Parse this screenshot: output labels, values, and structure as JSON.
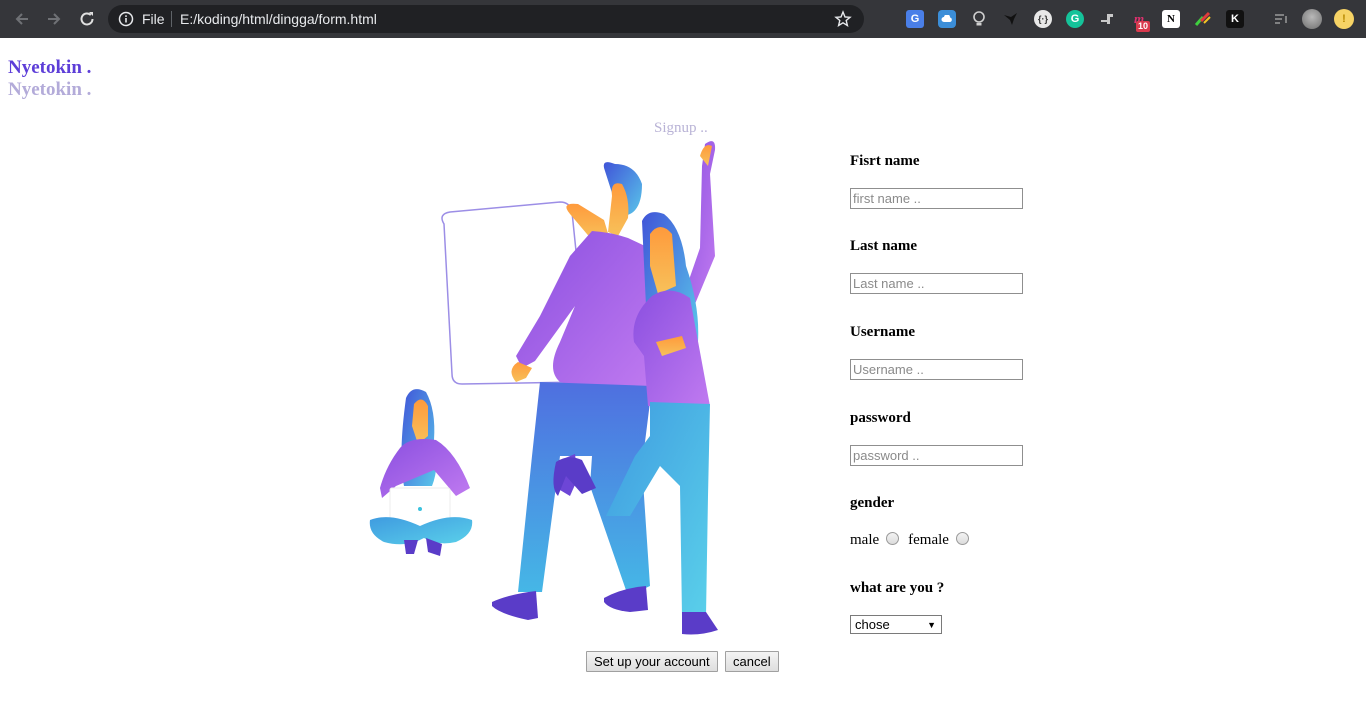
{
  "browser": {
    "scheme_label": "File",
    "url": "E:/koding/html/dingga/form.html",
    "extension_badge": "10",
    "extensions": [
      "translate-icon",
      "cloud-icon",
      "lightbulb-icon",
      "bird-icon",
      "code-icon",
      "grammarly-icon",
      "puzzle-icon",
      "mendeley-icon",
      "notion-icon",
      "color-icon",
      "k-icon",
      "media-icon",
      "avatar",
      "coin-icon"
    ]
  },
  "page": {
    "brand_primary": "Nyetokin .",
    "brand_shadow": "Nyetokin .",
    "signup_caption": "Signup ..",
    "accent_color": "#5d3ed8"
  },
  "form": {
    "first_name": {
      "label": "Fisrt name",
      "placeholder": "first name .."
    },
    "last_name": {
      "label": "Last name",
      "placeholder": "Last name .."
    },
    "username": {
      "label": "Username",
      "placeholder": "Username .."
    },
    "password": {
      "label": "password",
      "placeholder": "password .."
    },
    "gender": {
      "label": "gender",
      "options": [
        "male",
        "female"
      ]
    },
    "role": {
      "label": "what are you ?",
      "selected": "chose"
    }
  },
  "actions": {
    "submit_label": "Set up your account",
    "cancel_label": "cancel"
  }
}
